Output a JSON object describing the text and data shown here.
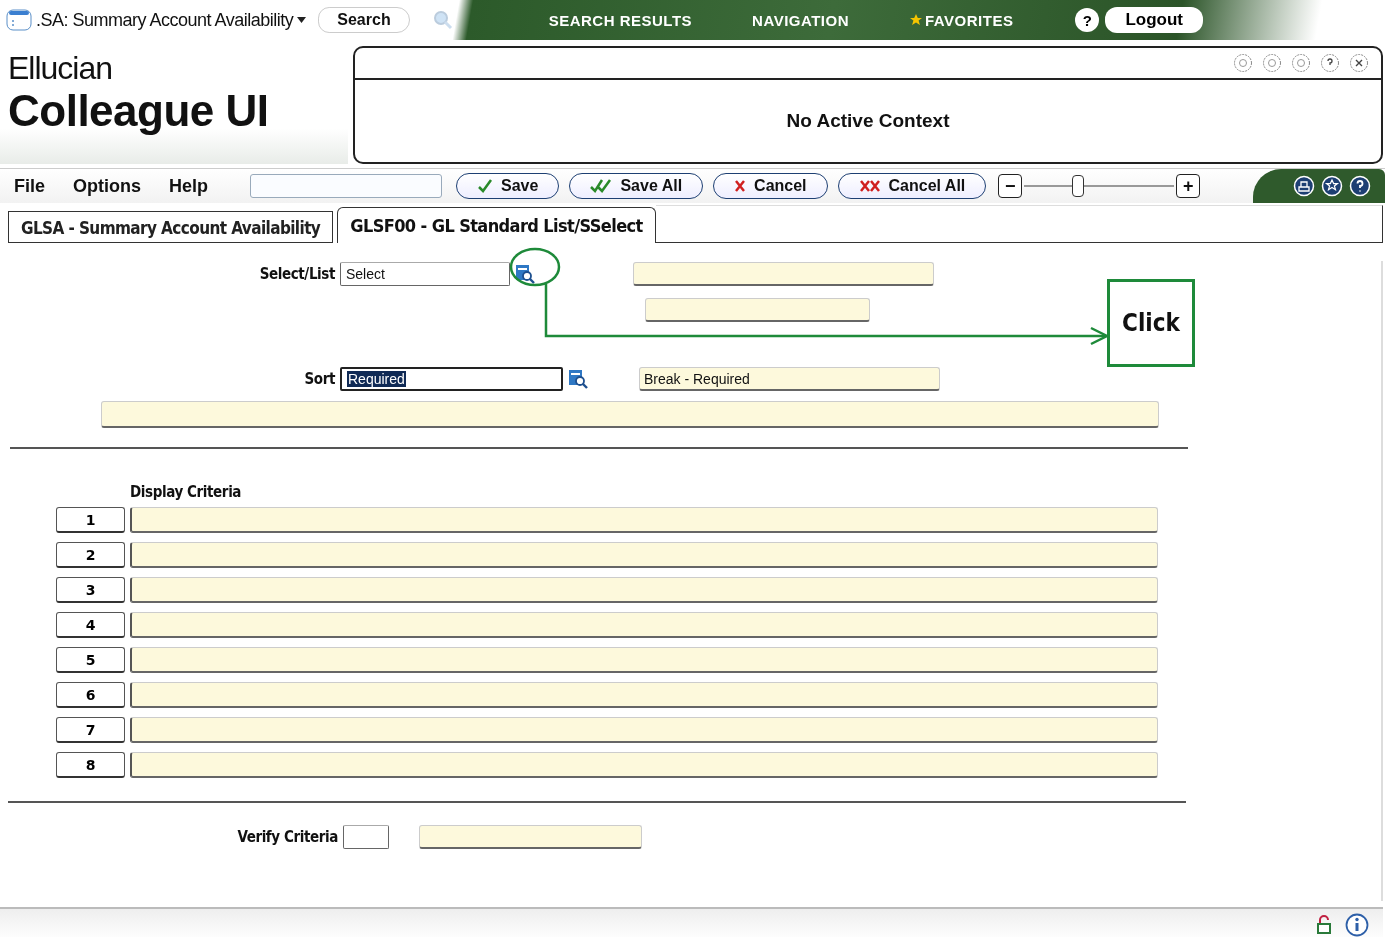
{
  "top_bar": {
    "app_title": ".SA: Summary Account Availability",
    "search_button": "Search",
    "nav_links": [
      {
        "label": "SEARCH RESULTS",
        "kind": "plain"
      },
      {
        "label": "NAVIGATION",
        "kind": "plain"
      },
      {
        "label": "FAVORITES",
        "kind": "star"
      }
    ],
    "help": "?",
    "logout": "Logout"
  },
  "header": {
    "brand_line1": "Ellucian",
    "brand_line2": "Colleague UI",
    "context": "No Active Context"
  },
  "menu": [
    "File",
    "Options",
    "Help"
  ],
  "toolbar": [
    {
      "label": "Save",
      "kind": "check"
    },
    {
      "label": "Save All",
      "kind": "double-check"
    },
    {
      "label": "Cancel",
      "kind": "x"
    },
    {
      "label": "Cancel All",
      "kind": "double-x"
    }
  ],
  "zoom_slider": {
    "minus": "−",
    "plus": "+",
    "level": 0.35
  },
  "tabs": [
    {
      "label": "GLSA - Summary Account Availability",
      "selected": false
    },
    {
      "label": "GLSF00 - GL Standard List/SSelect",
      "selected": true
    }
  ],
  "form": {
    "select_list": {
      "label": "Select/List",
      "value": "Select"
    },
    "sort": {
      "label": "Sort",
      "value": "Required",
      "text_selected": true
    },
    "break_field": {
      "value": "Break - Required"
    },
    "display_criteria": {
      "label": "Display Criteria",
      "rows": [
        "1",
        "2",
        "3",
        "4",
        "5",
        "6",
        "7",
        "8"
      ]
    },
    "verify": {
      "label": "Verify Criteria"
    }
  },
  "annotation": {
    "label": "Click"
  }
}
